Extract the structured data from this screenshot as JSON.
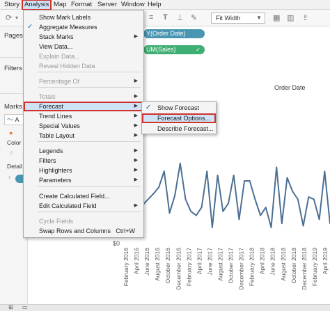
{
  "menubar": {
    "items": [
      "Story",
      "Analysis",
      "Map",
      "Format",
      "Server",
      "Window",
      "Help"
    ],
    "active_index": 1
  },
  "toolbar": {
    "fit_value": "Fit Width"
  },
  "left_panel": {
    "pages_label": "Pages",
    "filters_label": "Filters",
    "marks_label": "Marks",
    "mark_type_partial": "A",
    "color_label": "Color",
    "detail_label": "Detail"
  },
  "shelves": {
    "columns_pill": "Y(Order Date)",
    "rows_pill": "UM(Sales)"
  },
  "chart": {
    "header": "Order Date",
    "y_tick_zero": "$0",
    "x_tick_labels": [
      "February 2016",
      "April 2016",
      "June 2016",
      "August 2016",
      "October 2016",
      "December 2016",
      "February 2017",
      "April 2017",
      "June 2017",
      "August 2017",
      "October 2017",
      "December 2017",
      "February 2018",
      "April 2018",
      "June 2018",
      "August 2018",
      "October 2018",
      "December 2018",
      "February 2019",
      "April 2019"
    ],
    "line_color": "#4b6f93"
  },
  "chart_data": {
    "type": "line",
    "title": "",
    "xlabel": "",
    "ylabel": "",
    "x": [
      "Feb 2016",
      "Mar 2016",
      "Apr 2016",
      "May 2016",
      "Jun 2016",
      "Jul 2016",
      "Aug 2016",
      "Sep 2016",
      "Oct 2016",
      "Nov 2016",
      "Dec 2016",
      "Jan 2017",
      "Feb 2017",
      "Mar 2017",
      "Apr 2017",
      "May 2017",
      "Jun 2017",
      "Jul 2017",
      "Aug 2017",
      "Sep 2017",
      "Oct 2017",
      "Nov 2017",
      "Dec 2017",
      "Jan 2018",
      "Feb 2018",
      "Mar 2018",
      "Apr 2018",
      "May 2018",
      "Jun 2018",
      "Jul 2018",
      "Aug 2018",
      "Sep 2018",
      "Oct 2018",
      "Nov 2018",
      "Dec 2018",
      "Jan 2019",
      "Feb 2019",
      "Mar 2019",
      "Apr 2019"
    ],
    "values": [
      60,
      20,
      45,
      48,
      55,
      62,
      70,
      90,
      38,
      60,
      100,
      55,
      40,
      35,
      45,
      90,
      20,
      85,
      40,
      50,
      85,
      30,
      78,
      78,
      55,
      35,
      45,
      20,
      95,
      25,
      82,
      65,
      55,
      22,
      58,
      55,
      30,
      90,
      25
    ],
    "ylim": [
      0,
      130
    ]
  },
  "analysis_menu": {
    "items": [
      {
        "label": "Show Mark Labels"
      },
      {
        "label": "Aggregate Measures",
        "checked": true
      },
      {
        "label": "Stack Marks",
        "submenu": true
      },
      {
        "label": "View Data..."
      },
      {
        "label": "Explain Data...",
        "disabled": true
      },
      {
        "label": "Reveal Hidden Data",
        "disabled": true
      },
      {
        "label": "Percentage Of",
        "submenu": true,
        "disabled": true
      },
      {
        "label": "Totals",
        "submenu": true,
        "disabled": true
      },
      {
        "label": "Forecast",
        "submenu": true,
        "highlighted": true
      },
      {
        "label": "Trend Lines",
        "submenu": true
      },
      {
        "label": "Special Values",
        "submenu": true
      },
      {
        "label": "Table Layout",
        "submenu": true
      },
      {
        "label": "Legends",
        "submenu": true
      },
      {
        "label": "Filters",
        "submenu": true
      },
      {
        "label": "Highlighters",
        "submenu": true
      },
      {
        "label": "Parameters",
        "submenu": true
      },
      {
        "label": "Create Calculated Field..."
      },
      {
        "label": "Edit Calculated Field",
        "submenu": true
      },
      {
        "label": "Cycle Fields",
        "disabled": true
      },
      {
        "label": "Swap Rows and Columns",
        "shortcut": "Ctrl+W"
      }
    ]
  },
  "forecast_menu": {
    "items": [
      {
        "label": "Show Forecast",
        "checked": true
      },
      {
        "label": "Forecast Options...",
        "highlighted": true
      },
      {
        "label": "Describe Forecast..."
      }
    ]
  },
  "colors": {
    "menu_highlight": "#cfe3f6",
    "highlight_outline": "#d0312d",
    "pill_blue": "#4996b2",
    "pill_green": "#3fae73"
  }
}
